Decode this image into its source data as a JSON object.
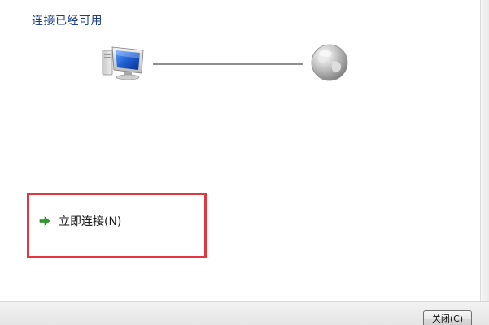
{
  "header": {
    "title": "连接已经可用"
  },
  "diagram": {
    "left_icon": "computer-icon",
    "right_icon": "globe-icon"
  },
  "actions": {
    "connect_label": "立即连接(N)",
    "connect_icon": "green-arrow-icon"
  },
  "footer": {
    "close_label": "关闭(C)"
  },
  "colors": {
    "title": "#1e3f8a",
    "highlight_border": "#e0383e",
    "arrow": "#2e9b2e"
  }
}
